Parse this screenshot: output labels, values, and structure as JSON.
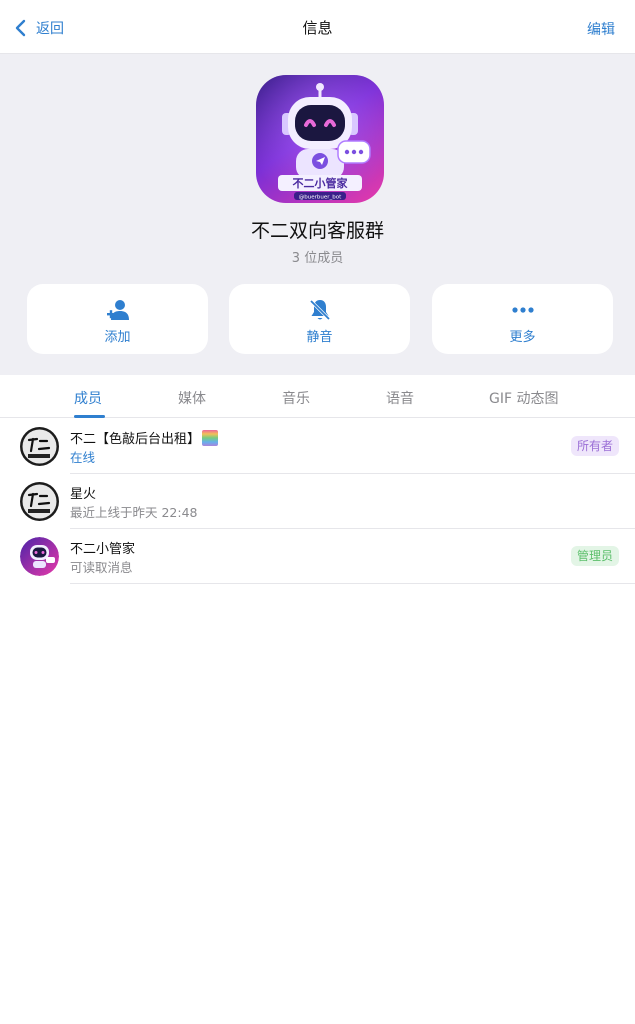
{
  "nav": {
    "back_label": "返回",
    "title": "信息",
    "edit_label": "编辑"
  },
  "group": {
    "avatar_text": "不二小管家",
    "avatar_subtext": "@buerbuer_bot",
    "name": "不二双向客服群",
    "member_count": "3 位成员"
  },
  "actions": [
    {
      "label": "添加",
      "icon": "add-user-icon"
    },
    {
      "label": "静音",
      "icon": "bell-muted-icon"
    },
    {
      "label": "更多",
      "icon": "more-dots-icon"
    }
  ],
  "tabs": [
    {
      "label": "成员",
      "active": true
    },
    {
      "label": "媒体",
      "active": false
    },
    {
      "label": "音乐",
      "active": false
    },
    {
      "label": "语音",
      "active": false
    },
    {
      "label": "GIF 动态图",
      "active": false
    }
  ],
  "members": [
    {
      "name": "不二【色敲后台出租】",
      "status": "在线",
      "online": true,
      "badge": "所有者",
      "avatar": "calligraphy"
    },
    {
      "name": "星火",
      "status": "最近上线于昨天 22:48",
      "online": false,
      "badge": "",
      "avatar": "calligraphy"
    },
    {
      "name": "不二小管家",
      "status": "可读取消息",
      "online": false,
      "badge": "管理员",
      "avatar": "robot"
    }
  ],
  "colors": {
    "accent": "#2f7fcf",
    "header_bg": "#efeff4",
    "owner_badge": "#9b6fd6",
    "admin_badge": "#5cbf6b"
  }
}
